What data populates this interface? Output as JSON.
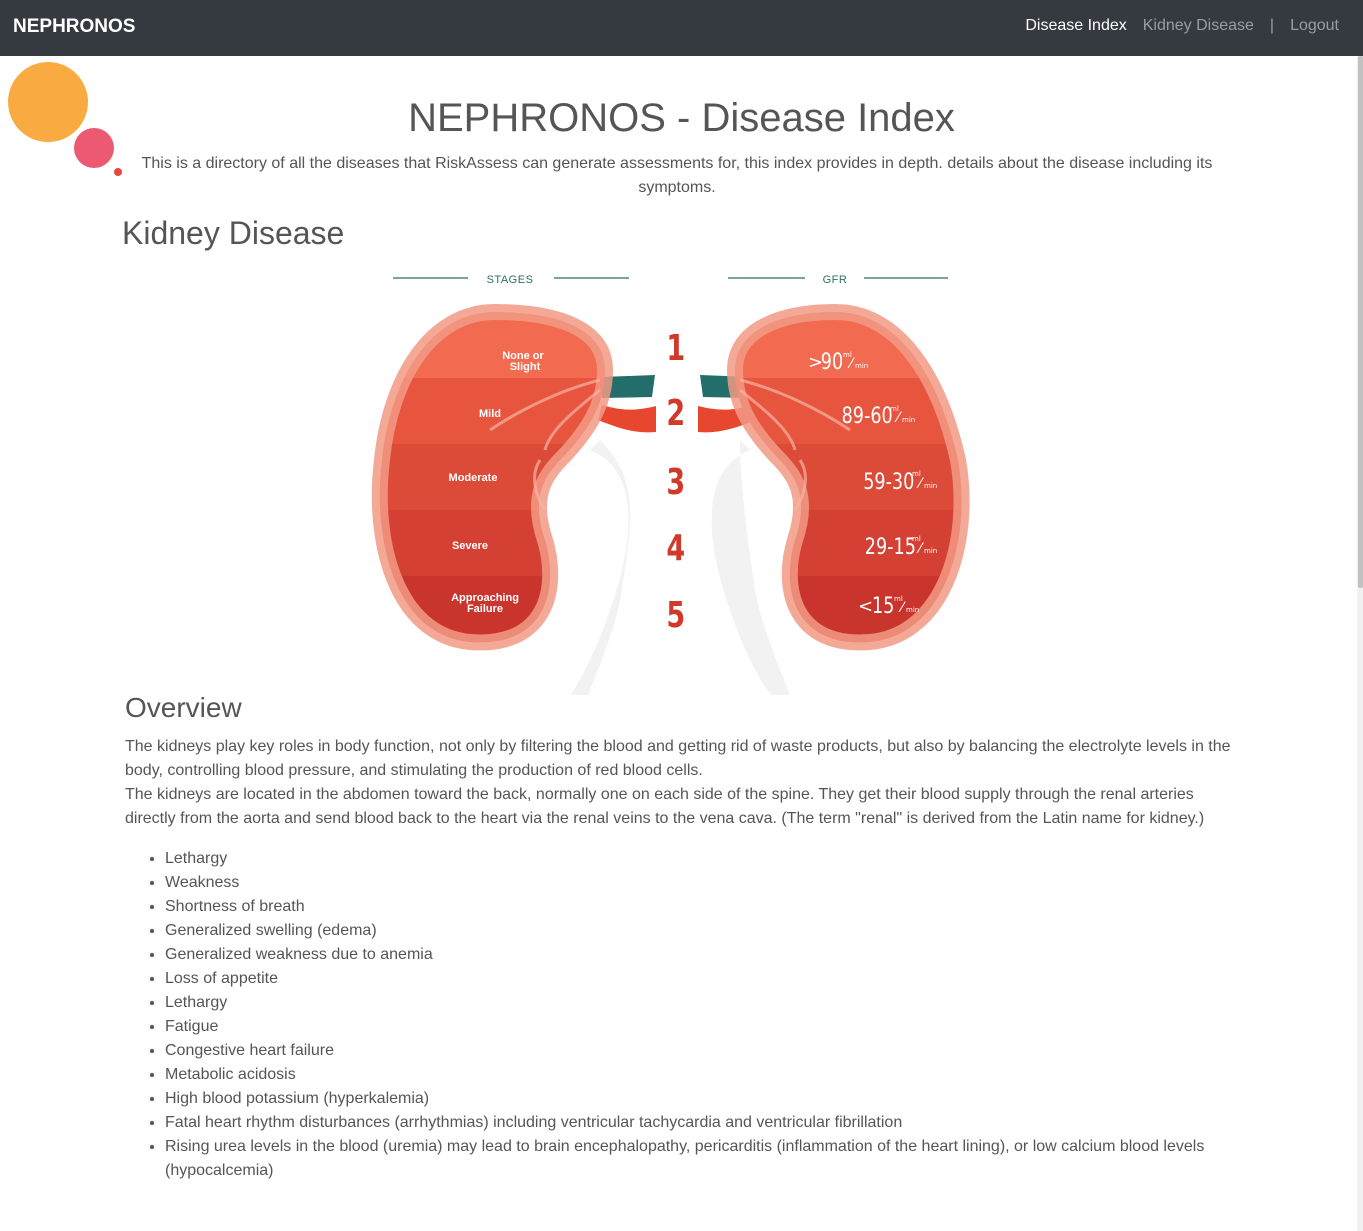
{
  "navbar": {
    "brand": "NEPHRONOS",
    "links": [
      "Disease Index",
      "Kidney Disease"
    ],
    "separator": "|",
    "logout": "Logout"
  },
  "header": {
    "title": "NEPHRONOS - Disease Index",
    "description": "This is a directory of all the diseases that RiskAssess can generate assessments for, this index provides in depth. details about the disease including its symptoms."
  },
  "disease": {
    "title": "Kidney Disease",
    "figure": {
      "stages_label": "STAGES",
      "gfr_label": "GFR",
      "stages": [
        {
          "number": "1",
          "name": [
            "None or",
            "Slight"
          ],
          "gfr_prefix": ">",
          "gfr_value": "90",
          "unit_top": "ml",
          "unit_bottom": "min"
        },
        {
          "number": "2",
          "name": [
            "Mild"
          ],
          "gfr_prefix": "",
          "gfr_value": "89-60",
          "unit_top": "ml",
          "unit_bottom": "min"
        },
        {
          "number": "3",
          "name": [
            "Moderate"
          ],
          "gfr_prefix": "",
          "gfr_value": "59-30",
          "unit_top": "ml",
          "unit_bottom": "min"
        },
        {
          "number": "4",
          "name": [
            "Severe"
          ],
          "gfr_prefix": "",
          "gfr_value": "29-15",
          "unit_top": "ml",
          "unit_bottom": "min"
        },
        {
          "number": "5",
          "name": [
            "Approaching",
            "Failure"
          ],
          "gfr_prefix": "<",
          "gfr_value": "15",
          "unit_top": "ml",
          "unit_bottom": "min"
        }
      ],
      "colors": {
        "stage1": "#f26a50",
        "stage2": "#e8553f",
        "stage3": "#dc4a38",
        "stage4": "#d44033",
        "stage5": "#c9352c",
        "outline": "#f29a85",
        "artery_teal": "#236d6b",
        "vein_red": "#e8472f",
        "number_red": "#d13a2b",
        "label_teal": "#2a6e6c"
      }
    },
    "overview_title": "Overview",
    "overview": [
      "The kidneys play key roles in body function, not only by filtering the blood and getting rid of waste products, but also by balancing the electrolyte levels in the body, controlling blood pressure, and stimulating the production of red blood cells.",
      "The kidneys are located in the abdomen toward the back, normally one on each side of the spine. They get their blood supply through the renal arteries directly from the aorta and send blood back to the heart via the renal veins to the vena cava. (The term \"renal\" is derived from the Latin name for kidney.)"
    ],
    "symptoms": [
      "Lethargy",
      "Weakness",
      "Shortness of breath",
      "Generalized swelling (edema)",
      "Generalized weakness due to anemia",
      "Loss of appetite",
      "Lethargy",
      "Fatigue",
      "Congestive heart failure",
      "Metabolic acidosis",
      "High blood potassium (hyperkalemia)",
      "Fatal heart rhythm disturbances (arrhythmias) including ventricular tachycardia and ventricular fibrillation",
      "Rising urea levels in the blood (uremia) may lead to brain encephalopathy, pericarditis (inflammation of the heart lining), or low calcium blood levels (hypocalcemia)"
    ]
  }
}
